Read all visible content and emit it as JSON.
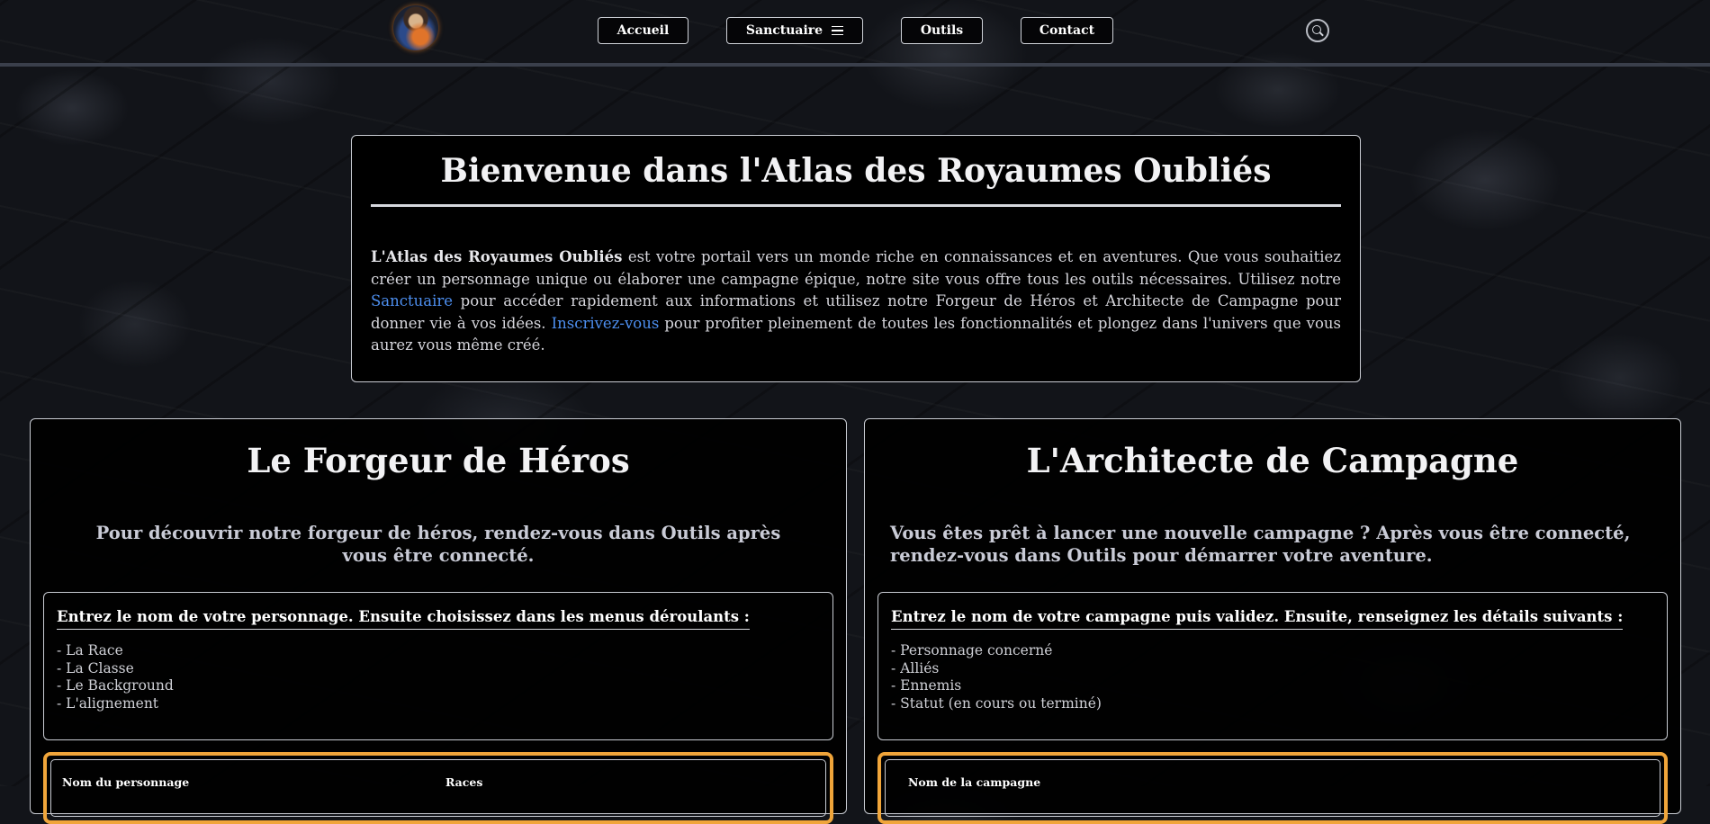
{
  "nav": {
    "items": [
      {
        "label": "Accueil"
      },
      {
        "label": "Sanctuaire"
      },
      {
        "label": "Outils"
      },
      {
        "label": "Contact"
      }
    ]
  },
  "welcome": {
    "title": "Bienvenue dans l'Atlas des Royaumes Oubliés",
    "brand": "L'Atlas des Royaumes Oubliés",
    "text_1": " est votre portail vers un monde riche en connaissances et en aventures. Que vous souhaitiez créer un personnage unique ou élaborer une campagne épique, notre site vous offre tous les outils nécessaires. Utilisez notre ",
    "link_sanctuaire": "Sanctuaire",
    "text_2": " pour accéder rapidement aux informations et utilisez notre Forgeur de Héros et Architecte de Campagne pour donner vie à vos idées. ",
    "link_register": "Inscrivez-vous",
    "text_3": " pour profiter pleinement de toutes les fonctionnalités et plongez dans l'univers que vous aurez vous même créé."
  },
  "forgeur": {
    "title": "Le Forgeur de Héros",
    "lead": "Pour découvrir notre forgeur de héros, rendez-vous dans Outils après vous être connecté.",
    "instructions_title": "Entrez le nom de votre personnage. Ensuite choisissez dans les menus déroulants :",
    "items": [
      "- La Race",
      "- La Classe",
      "- Le Background",
      "- L'alignement"
    ],
    "form_labels": [
      "Nom du personnage",
      "Races"
    ]
  },
  "architecte": {
    "title": "L'Architecte de Campagne",
    "lead": "Vous êtes prêt à lancer une nouvelle campagne ? Après vous être connecté, rendez-vous dans Outils pour démarrer votre aventure.",
    "instructions_title": "Entrez le nom de votre campagne puis validez. Ensuite, renseignez les détails suivants :",
    "items": [
      "- Personnage concerné",
      "- Alliés",
      "- Ennemis",
      "- Statut (en cours ou terminé)"
    ],
    "form_labels": [
      "Nom de la campagne"
    ]
  },
  "colors": {
    "accent": "#f0a53a",
    "link": "#4d8ff0"
  },
  "icons": {
    "search": "search-icon",
    "menu": "hamburger-icon",
    "logo": "wizard-avatar-logo"
  }
}
